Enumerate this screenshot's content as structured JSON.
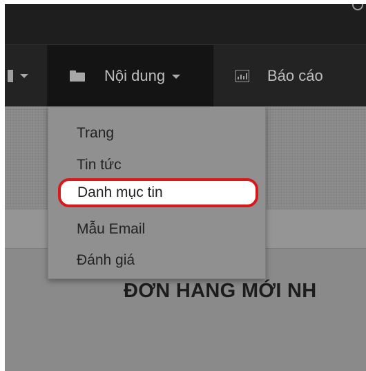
{
  "navbar": {
    "content_menu": {
      "label": "Nội dung",
      "icon": "folder-icon"
    },
    "report_menu": {
      "label": "Báo cáo",
      "icon": "bar-chart-icon"
    }
  },
  "dropdown": {
    "items": [
      {
        "label": "Trang"
      },
      {
        "label": "Tin tức"
      },
      {
        "label": "Danh mục tin",
        "highlighted": true
      },
      {
        "label": "Mẫu Email"
      },
      {
        "label": "Đánh giá"
      }
    ]
  },
  "main": {
    "title": "ĐƠN HANG MỚI NH"
  },
  "colors": {
    "navbar_bg": "#232323",
    "active_nav_bg": "#141414",
    "highlight_border": "#d7191c"
  }
}
